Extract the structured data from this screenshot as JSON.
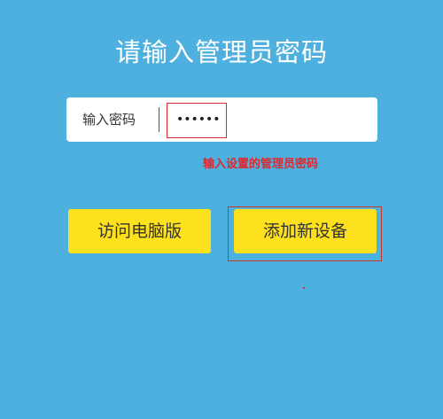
{
  "title": "请输入管理员密码",
  "password": {
    "label": "输入密码",
    "value": "••••••"
  },
  "hint": "输入设置的管理员密码",
  "buttons": {
    "pc_label": "访问电脑版",
    "add_device_label": "添加新设备"
  },
  "colors": {
    "background": "#4db0de",
    "button": "#fde11c",
    "annotation": "#e0272d"
  }
}
